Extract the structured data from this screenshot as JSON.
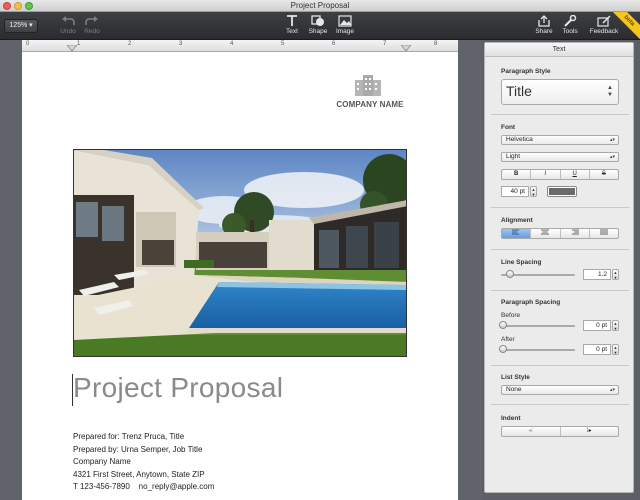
{
  "window": {
    "title": "Project Proposal"
  },
  "toolbar": {
    "zoom": "125%",
    "undo": "Undo",
    "redo": "Redo",
    "text": "Text",
    "shape": "Shape",
    "image": "Image",
    "share": "Share",
    "tools": "Tools",
    "feedback": "Feedback",
    "beta": "beta"
  },
  "ruler": {
    "ticks": [
      "0",
      "1",
      "2",
      "3",
      "4",
      "5",
      "6",
      "7",
      "8"
    ]
  },
  "document": {
    "company": "COMPANY NAME",
    "title": "Project Proposal",
    "lines": [
      "Prepared for: Trenz Pruca, Title",
      "Prepared by: Urna Semper, Job Title",
      "Company Name",
      "4321 First Street, Anytown, State ZIP",
      "T 123-456-7890    no_reply@apple.com"
    ]
  },
  "inspector": {
    "title": "Text",
    "paragraph_style_label": "Paragraph Style",
    "paragraph_style": "Title",
    "font_label": "Font",
    "font_family": "Helvetica",
    "font_weight": "Light",
    "style_buttons": [
      "B",
      "I",
      "U",
      "S"
    ],
    "font_size": "40 pt",
    "text_color": "#6b6b6b",
    "alignment_label": "Alignment",
    "line_spacing_label": "Line Spacing",
    "line_spacing": "1.2",
    "line_spacing_level": 0.12,
    "paragraph_spacing_label": "Paragraph Spacing",
    "before_label": "Before",
    "before_value": "0 pt",
    "after_label": "After",
    "after_value": "0 pt",
    "list_style_label": "List Style",
    "list_style": "None",
    "indent_label": "Indent"
  },
  "colors": {
    "accent": "#4a90e2",
    "beta": "#f4c51d"
  }
}
